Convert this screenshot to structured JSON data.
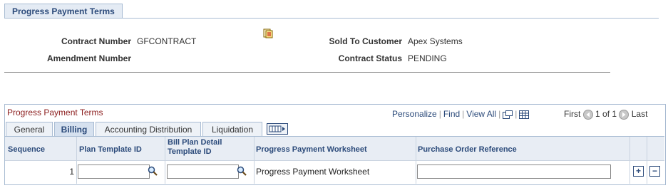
{
  "page_tab": {
    "label": "Progress Payment Terms"
  },
  "header": {
    "contract_number_label": "Contract Number",
    "contract_number_value": "GFCONTRACT",
    "amendment_number_label": "Amendment Number",
    "sold_to_customer_label": "Sold To Customer",
    "sold_to_customer_value": "Apex Systems",
    "contract_status_label": "Contract Status",
    "contract_status_value": "PENDING"
  },
  "grid": {
    "title": "Progress Payment Terms",
    "personalize": "Personalize",
    "find": "Find",
    "view_all": "View All",
    "first": "First",
    "range": "1 of 1",
    "last": "Last",
    "tabs": [
      "General",
      "Billing",
      "Accounting Distribution",
      "Liquidation"
    ],
    "columns": {
      "sequence": "Sequence",
      "plan_template_id": "Plan Template ID",
      "bill_plan_detail_1": "Bill Plan Detail",
      "bill_plan_detail_2": "Template ID",
      "worksheet": "Progress Payment Worksheet",
      "po_reference": "Purchase Order Reference"
    },
    "rows": [
      {
        "sequence": "1",
        "plan_template_id": "",
        "bill_plan_detail_template_id": "",
        "worksheet": "Progress Payment Worksheet",
        "po_reference": ""
      }
    ]
  }
}
